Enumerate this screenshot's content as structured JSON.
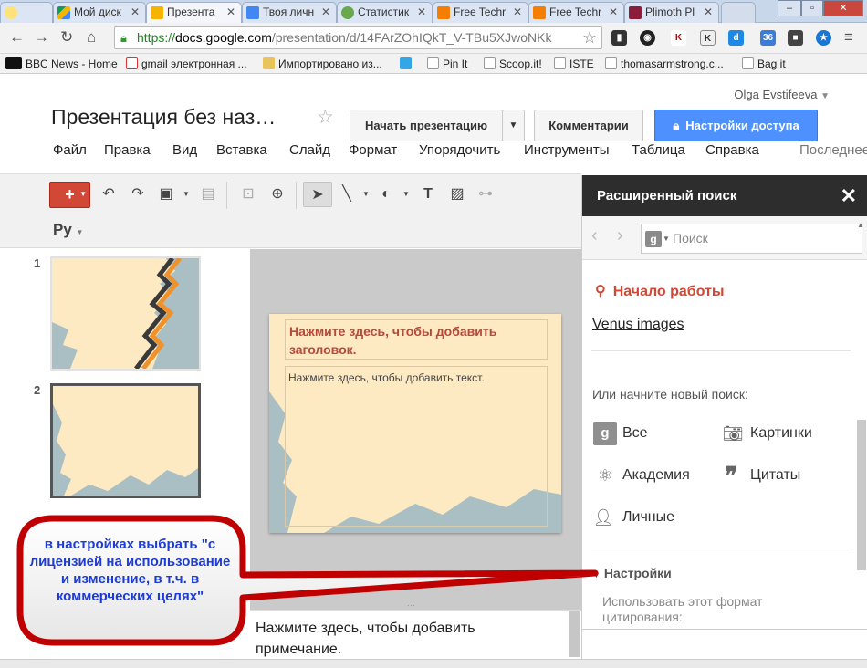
{
  "browser": {
    "tabs": [
      {
        "label": "Мой диск",
        "icon": "google-drive-icon",
        "color": "#f4b400"
      },
      {
        "label": "Презента",
        "icon": "google-slides-icon",
        "color": "#f4b400",
        "active": true
      },
      {
        "label": "Твоя личн",
        "icon": "google-docs-icon",
        "color": "#4285f4"
      },
      {
        "label": "Статистик",
        "icon": "yandex-icon",
        "color": "#6aa84f"
      },
      {
        "label": "Free Techr",
        "icon": "blogger-icon",
        "color": "#f57d00"
      },
      {
        "label": "Free Techr",
        "icon": "blogger-icon",
        "color": "#f57d00"
      },
      {
        "label": "Plimoth Pl",
        "icon": "site-icon",
        "color": "#8b1c3a"
      }
    ],
    "url": {
      "scheme": "https://",
      "host": "docs.google.com",
      "path": "/presentation/d/14FArZOhIQkT_V-TBu5XJwoNKk"
    },
    "extension_badge": "36",
    "bookmarks": [
      {
        "label": "BBC News - Home",
        "icon": "bbc-icon"
      },
      {
        "label": "gmail электронная ...",
        "icon": "gmail-icon"
      },
      {
        "label": "Импортировано из...",
        "icon": "folder-icon"
      },
      {
        "label": "",
        "icon": "twitter-icon"
      },
      {
        "label": "Pin It",
        "icon": "page-icon"
      },
      {
        "label": "Scoop.it!",
        "icon": "page-icon"
      },
      {
        "label": "ISTE",
        "icon": "page-icon"
      },
      {
        "label": "thomasarmstrong.c...",
        "icon": "page-icon"
      },
      {
        "label": "Bag it",
        "icon": "page-icon"
      }
    ]
  },
  "docs": {
    "user": "Olga Evstifeeva",
    "title": "Презентация без наз…",
    "buttons": {
      "present": "Начать презентацию",
      "comments": "Комментарии",
      "share": "Настройки доступа"
    },
    "menu": [
      "Файл",
      "Правка",
      "Вид",
      "Вставка",
      "Слайд",
      "Формат",
      "Упорядочить",
      "Инструменты",
      "Таблица",
      "Справка"
    ],
    "last_edit": "Последнее",
    "toolbar": {
      "add": "+",
      "language": "Ру"
    },
    "slides": [
      {
        "number": "1"
      },
      {
        "number": "2"
      }
    ],
    "slide": {
      "title_placeholder": "Нажмите здесь, чтобы добавить заголовок.",
      "body_placeholder": "Нажмите здесь, чтобы добавить текст."
    },
    "notes_placeholder": "Нажмите здесь, чтобы добавить примечание."
  },
  "panel": {
    "title": "Расширенный поиск",
    "search_placeholder": "Поиск",
    "search_engine_letter": "g",
    "start_heading": "Начало работы",
    "result_link": "Venus images",
    "new_search_label": "Или начните новый поиск:",
    "search_types": [
      {
        "label": "Все",
        "icon": "google-icon"
      },
      {
        "label": "Картинки",
        "icon": "camera-icon"
      },
      {
        "label": "Академия",
        "icon": "atom-icon"
      },
      {
        "label": "Цитаты",
        "icon": "quote-icon"
      },
      {
        "label": "Личные",
        "icon": "person-icon"
      }
    ],
    "settings_heading": "Настройки",
    "citation_label": "Использовать этот формат цитирования:"
  },
  "callout": {
    "text": "в настройках выбрать \"с лицензией на использование и изменение, в т.ч. в коммерческих целях\"",
    "border_color": "#c00000",
    "text_color": "#1d3bd6"
  }
}
